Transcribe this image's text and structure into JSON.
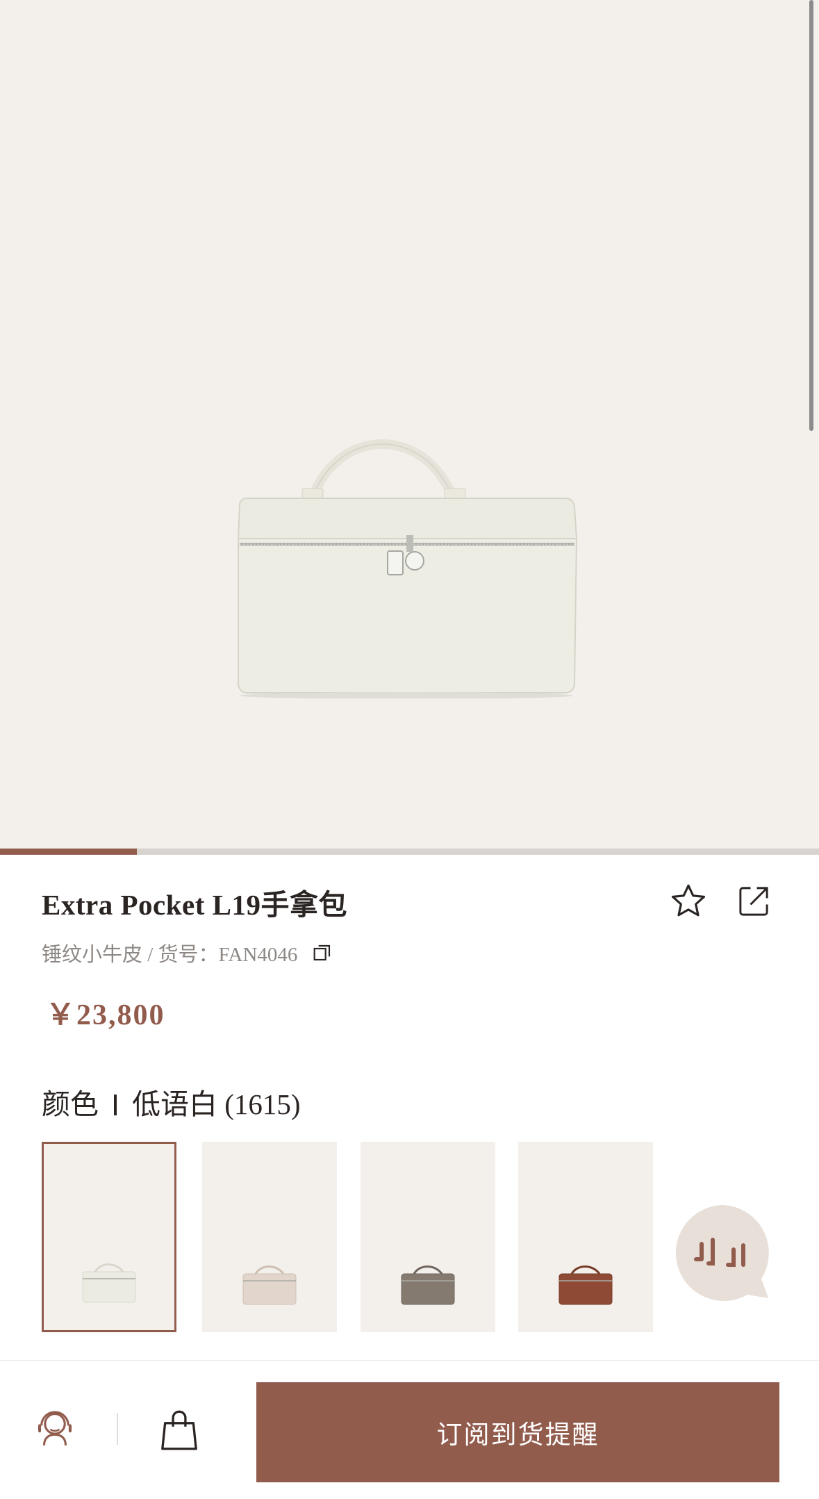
{
  "product": {
    "title": "Extra Pocket L19手拿包",
    "subtitle": "锤纹小牛皮 / 货号：FAN4046",
    "price": "￥23,800"
  },
  "gallery": {
    "progress_fraction": 0.167
  },
  "color": {
    "label": "颜色",
    "selected_name": "低语白 (1615)",
    "swatches": [
      {
        "bag_color": "#ecebe2",
        "accent": "#d9d7cc"
      },
      {
        "bag_color": "#e2d6cc",
        "accent": "#cdbfb2"
      },
      {
        "bag_color": "#857a70",
        "accent": "#6f655c"
      },
      {
        "bag_color": "#8e4a35",
        "accent": "#763a28"
      }
    ]
  },
  "actions": {
    "notify_label": "订阅到货提醒"
  },
  "colors": {
    "accent": "#925c4d",
    "hero_bg": "#f3f0eb"
  },
  "icons": [
    "star-icon",
    "share-icon",
    "copy-icon",
    "chat-icon",
    "customer-service-icon",
    "shopping-bag-icon"
  ]
}
